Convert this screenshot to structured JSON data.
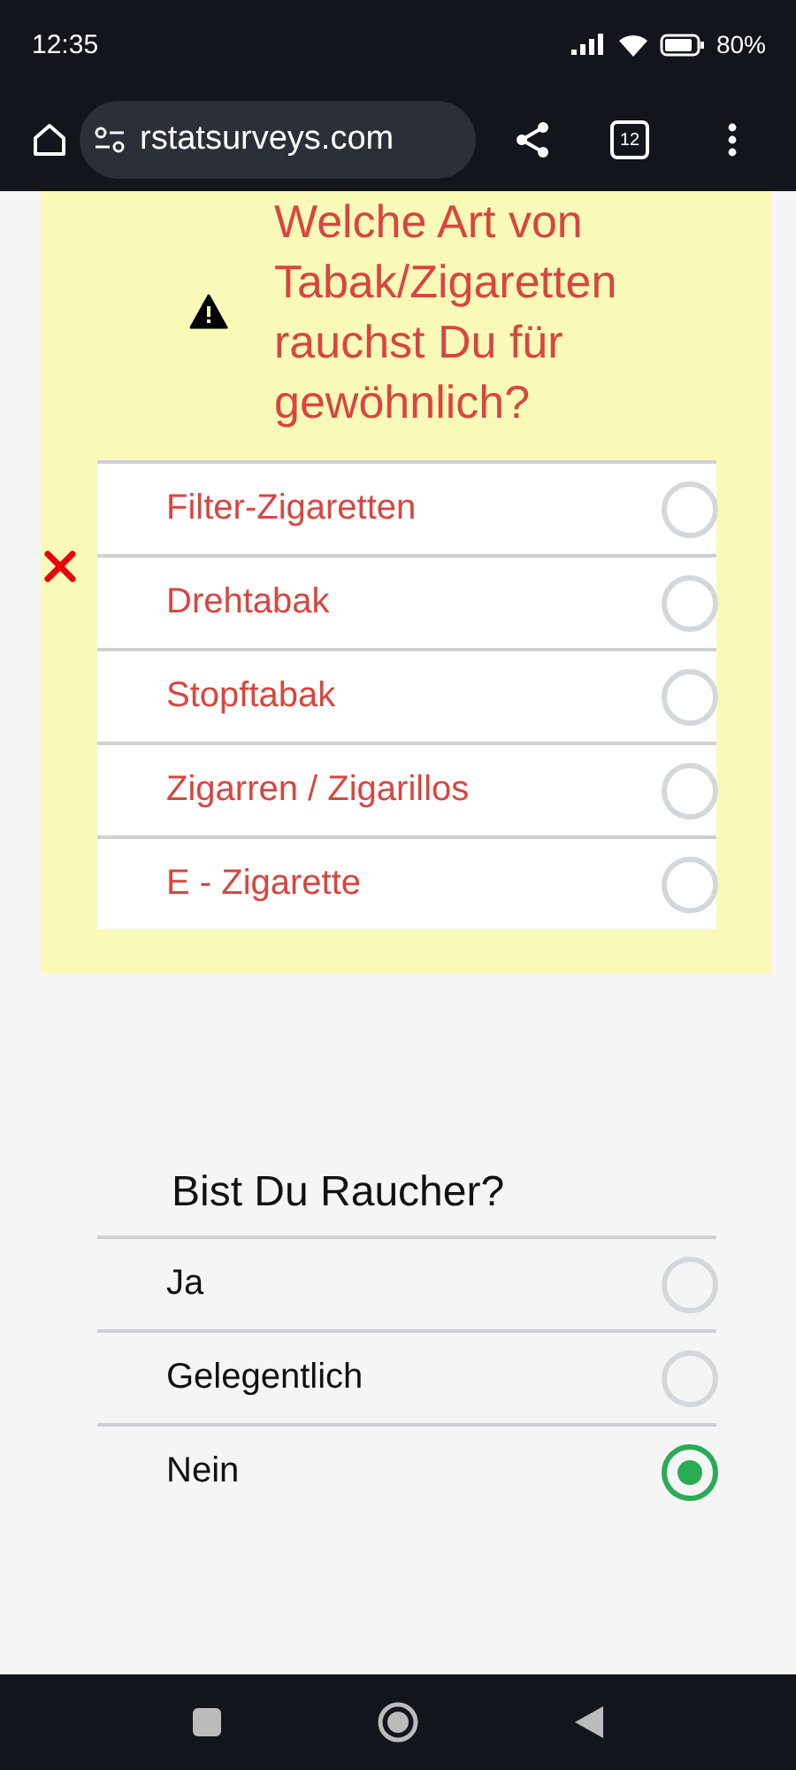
{
  "status_bar": {
    "time": "12:35",
    "battery": "80%"
  },
  "browser": {
    "url": "rstatsurveys.com",
    "tab_count": "12"
  },
  "questions": [
    {
      "title": "Welche Art von Tabak/Zigaretten rauchst Du für gewöhnlich?",
      "error": true,
      "options": [
        {
          "label": "Filter-Zigaretten",
          "selected": false
        },
        {
          "label": "Drehtabak",
          "selected": false
        },
        {
          "label": "Stopftabak",
          "selected": false
        },
        {
          "label": "Zigarren / Zigarillos",
          "selected": false
        },
        {
          "label": "E - Zigarette",
          "selected": false
        }
      ]
    },
    {
      "title": "Bist Du Raucher?",
      "error": false,
      "options": [
        {
          "label": "Ja",
          "selected": false
        },
        {
          "label": "Gelegentlich",
          "selected": false
        },
        {
          "label": "Nein",
          "selected": true
        }
      ]
    }
  ]
}
